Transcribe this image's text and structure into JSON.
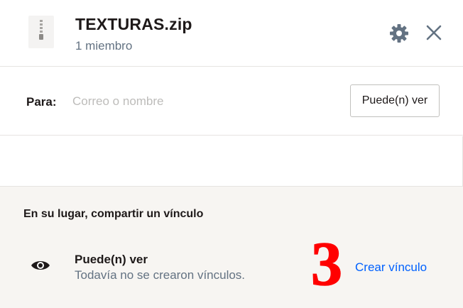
{
  "file": {
    "name": "TEXTURAS.zip",
    "members": "1 miembro",
    "icon": "zip-file-icon"
  },
  "header": {
    "settings_icon": "gear-icon",
    "close_icon": "close-icon"
  },
  "share": {
    "to_label": "Para:",
    "input_placeholder": "Correo o nombre",
    "input_value": "",
    "permission_button": "Puede(n) ver"
  },
  "link": {
    "section_title": "En su lugar, compartir un vínculo",
    "permission": "Puede(n) ver",
    "status": "Todavía no se crearon vínculos.",
    "create_label": "Crear vínculo",
    "icon": "eye-icon",
    "step_badge": "3"
  },
  "colors": {
    "accent": "#0061fe",
    "badge": "#ff0000",
    "secondary_text": "#637282",
    "section_bg": "#f7f5f2"
  }
}
